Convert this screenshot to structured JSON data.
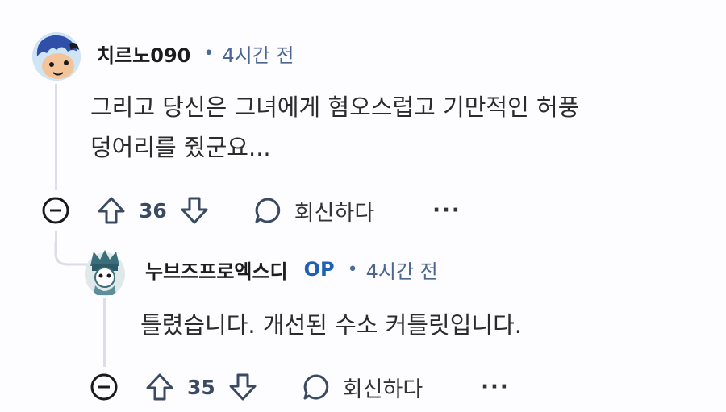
{
  "comments": [
    {
      "username": "치르노090",
      "op_label": "",
      "separator": "•",
      "time": "4시간 전",
      "lines": [
        "그리고 당신은 그녀에게 혐오스럽고 기만적인 허풍",
        "덩어리를 줬군요..."
      ],
      "votes": "36",
      "reply_label": "회신하다",
      "more_label": "···",
      "avatar_colors": {
        "bg": "#2f4fa8",
        "face": "#f3c39a"
      }
    },
    {
      "username": "누브즈프로엑스디",
      "op_label": "OP",
      "separator": "•",
      "time": "4시간 전",
      "lines": [
        "틀렸습니다. 개선된 수소 커틀릿입니다."
      ],
      "votes": "35",
      "reply_label": "회신하다",
      "more_label": "···",
      "avatar_colors": {
        "bg": "#dfe9ea",
        "hat": "#3a6e7a"
      }
    }
  ],
  "icons": [
    "collapse-icon",
    "upvote-icon",
    "downvote-icon",
    "reply-bubble-icon",
    "more-options-icon"
  ],
  "colors": {
    "thread_line": "#dcdde6",
    "op": "#1f5fb4",
    "time": "#4b6690"
  }
}
